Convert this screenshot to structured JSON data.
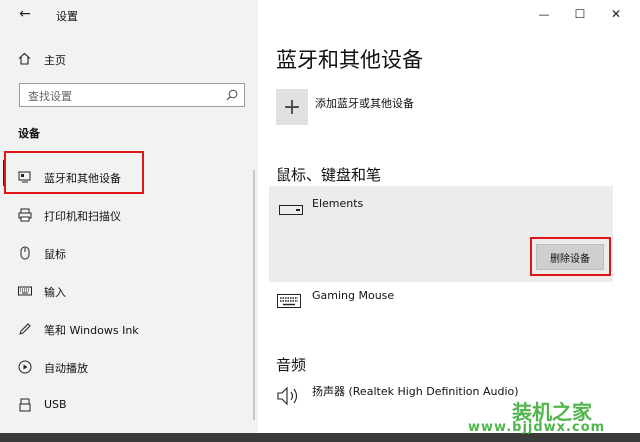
{
  "window": {
    "title": "设置",
    "back_glyph": "←",
    "minimize_glyph": "—",
    "maximize_glyph": "☐",
    "close_glyph": "✕"
  },
  "sidebar": {
    "home_label": "主页",
    "search_placeholder": "查找设置",
    "section_title": "设备",
    "items": [
      {
        "label": "蓝牙和其他设备",
        "icon": "bluetooth-devices-icon",
        "selected": true
      },
      {
        "label": "打印机和扫描仪",
        "icon": "printer-icon",
        "selected": false
      },
      {
        "label": "鼠标",
        "icon": "mouse-icon",
        "selected": false
      },
      {
        "label": "输入",
        "icon": "keyboard-icon",
        "selected": false
      },
      {
        "label": "笔和 Windows Ink",
        "icon": "pen-icon",
        "selected": false
      },
      {
        "label": "自动播放",
        "icon": "autoplay-icon",
        "selected": false
      },
      {
        "label": "USB",
        "icon": "usb-icon",
        "selected": false
      }
    ]
  },
  "main": {
    "page_title": "蓝牙和其他设备",
    "add_device_label": "添加蓝牙或其他设备",
    "mouse_section_title": "鼠标、键盘和笔",
    "devices": [
      {
        "name": "Elements",
        "icon": "drive-icon"
      },
      {
        "name": "Gaming Mouse",
        "icon": "keyboard-icon"
      }
    ],
    "remove_button_label": "删除设备",
    "audio_section_title": "音频",
    "audio_device": "扬声器 (Realtek High Definition Audio)"
  },
  "watermark": {
    "brand": "装机之家",
    "url": "www.bjjdwx.com"
  },
  "colors": {
    "sidebar_bg": "#f2f2f2",
    "highlight_red": "#e01616",
    "selection_bar": "#1a1a8a",
    "watermark_green": "#3fae3a"
  }
}
